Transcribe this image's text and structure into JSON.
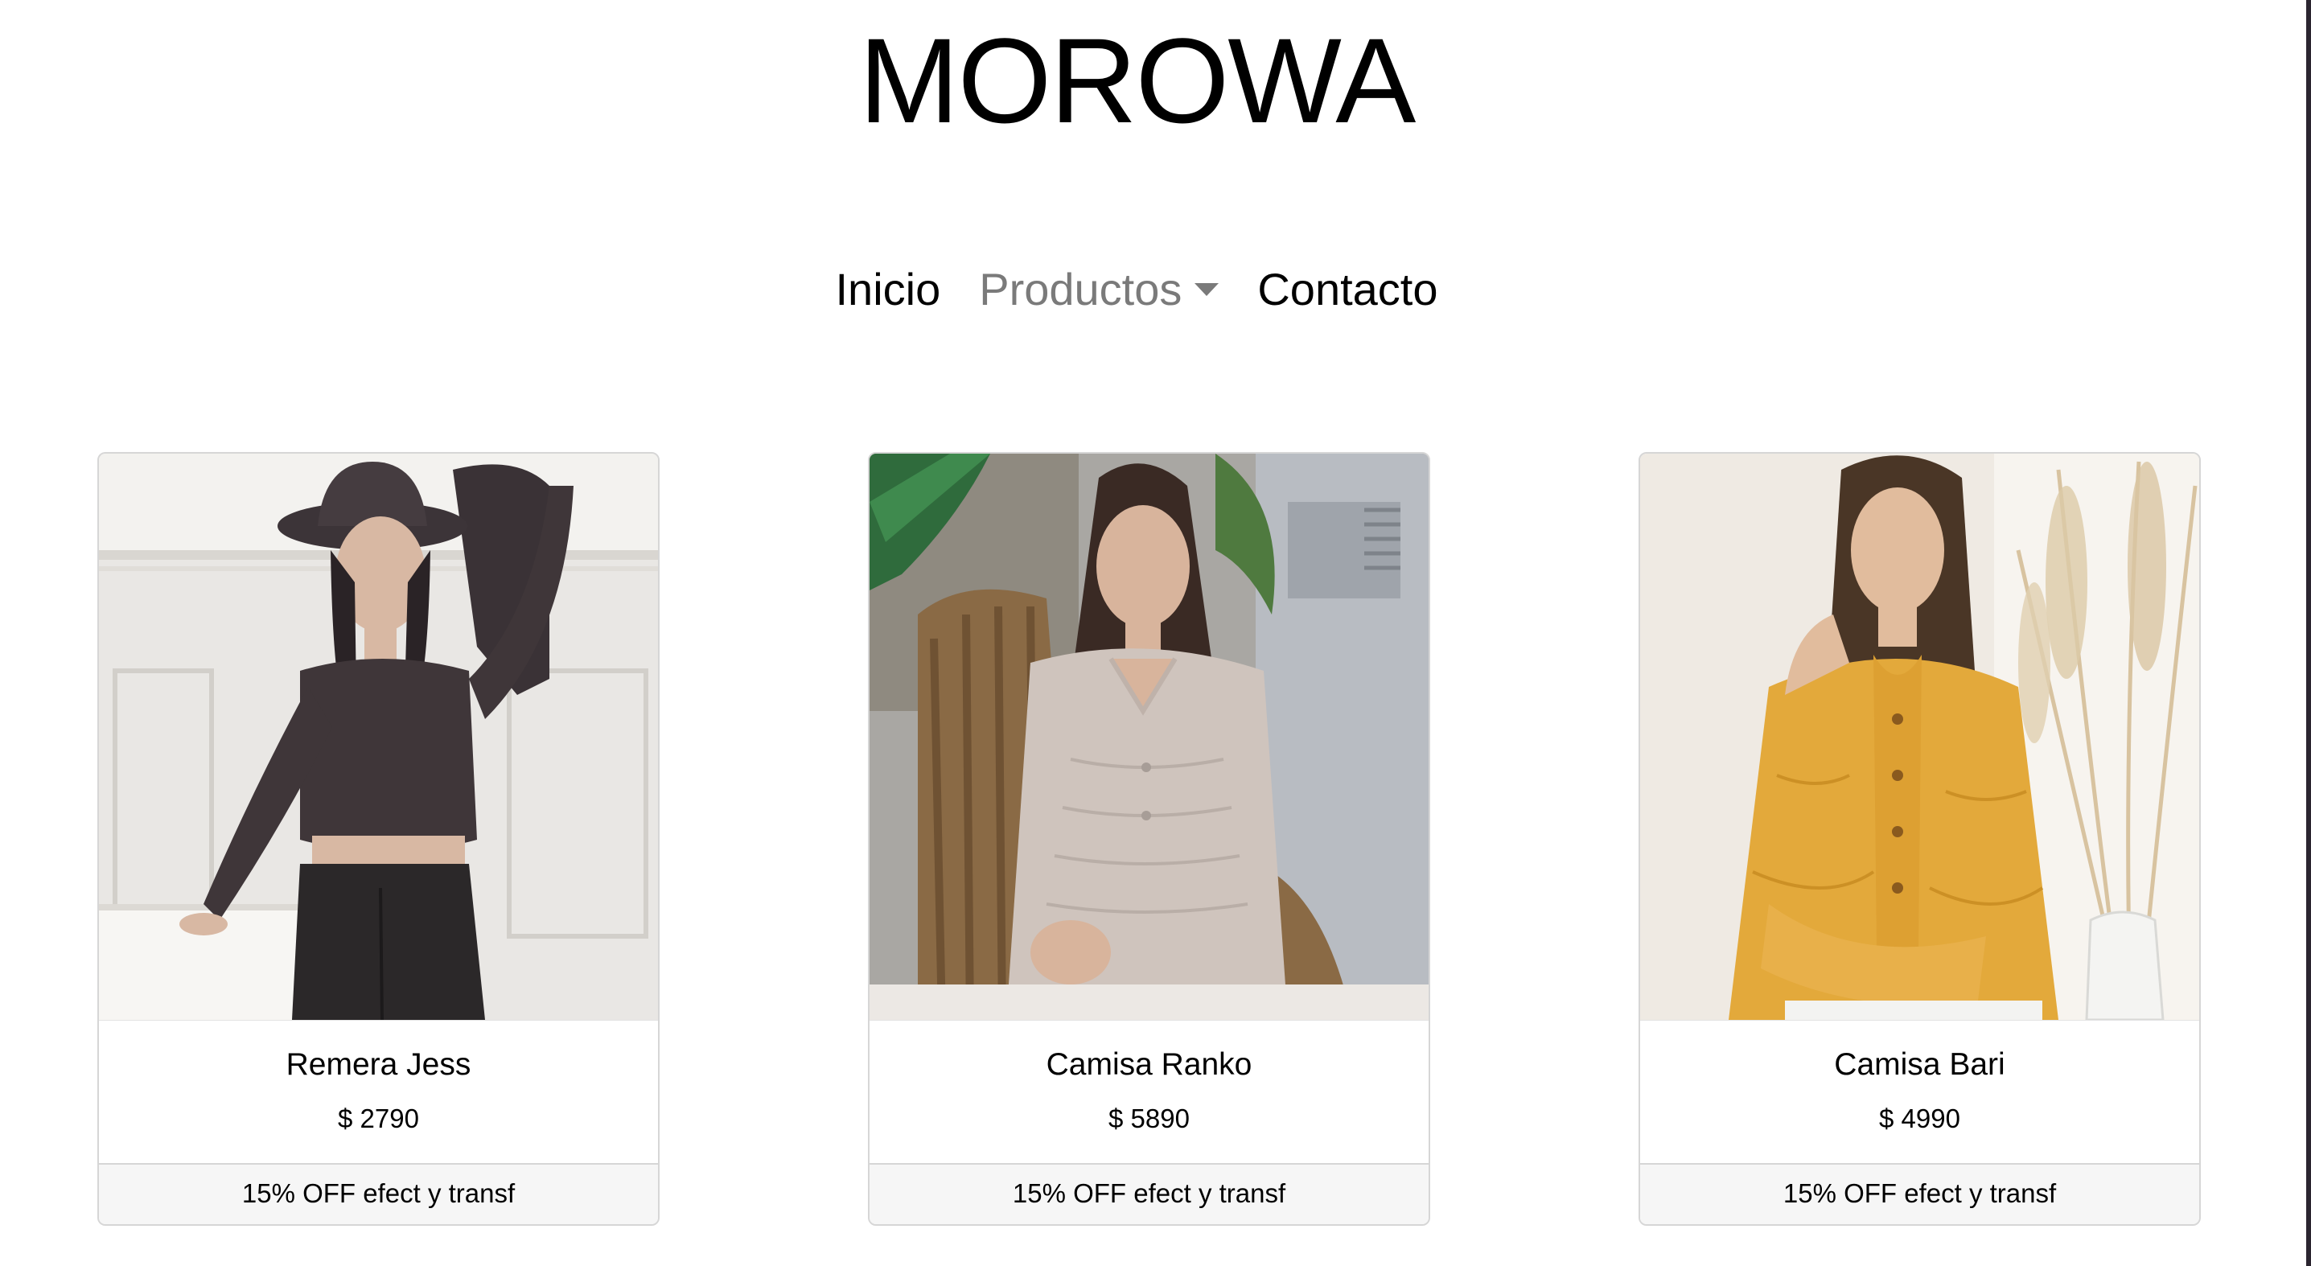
{
  "brand": {
    "name": "MOROWA"
  },
  "nav": {
    "items": [
      {
        "label": "Inicio"
      },
      {
        "label": "Productos",
        "dropdown": true
      },
      {
        "label": "Contacto"
      }
    ]
  },
  "products": [
    {
      "title": "Remera Jess",
      "price": "$ 2790",
      "footer": "15% OFF efect y transf",
      "image": "woman-in-hat-dark-wrap-top-photo"
    },
    {
      "title": "Camisa Ranko",
      "price": "$ 5890",
      "footer": "15% OFF efect y transf",
      "image": "woman-in-beige-blouse-on-wicker-chair-photo"
    },
    {
      "title": "Camisa Bari",
      "price": "$ 4990",
      "footer": "15% OFF efect y transf",
      "image": "woman-in-mustard-blouse-with-pampas-photo"
    }
  ],
  "colors": {
    "nav_active": "#000000",
    "nav_muted": "#7a7a7a",
    "card_border": "#d6d6d6",
    "card_footer_bg": "#f6f6f6"
  }
}
